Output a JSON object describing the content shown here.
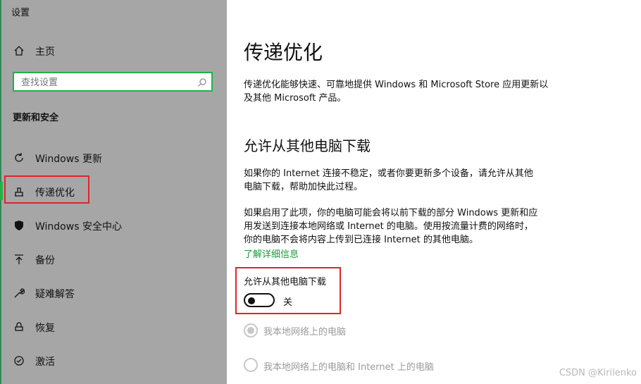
{
  "app": {
    "title": "设置"
  },
  "sidebar": {
    "home_label": "主页",
    "search_placeholder": "查找设置",
    "section_title": "更新和安全",
    "items": [
      {
        "label": "Windows 更新",
        "icon": "refresh-icon"
      },
      {
        "label": "传递优化",
        "icon": "delivery-optimization-icon",
        "active": true
      },
      {
        "label": "Windows 安全中心",
        "icon": "shield-icon"
      },
      {
        "label": "备份",
        "icon": "upload-arrow-icon"
      },
      {
        "label": "疑难解答",
        "icon": "wrench-icon"
      },
      {
        "label": "恢复",
        "icon": "recovery-icon"
      },
      {
        "label": "激活",
        "icon": "activation-icon"
      }
    ],
    "accent_color": "#22b14c"
  },
  "main": {
    "title": "传递优化",
    "intro_line1": "传递优化能够快速、可靠地提供 Windows 和 Microsoft Store 应用更新以",
    "intro_line2": "及其他 Microsoft 产品。",
    "section_title": "允许从其他电脑下载",
    "para1_line1": "如果你的 Internet 连接不稳定，或者你要更新多个设备，请允许从其他",
    "para1_line2": "电脑下载，帮助加快此过程。",
    "para2_line1": "如果启用了此项，你的电脑可能会将以前下载的部分 Windows 更新和应",
    "para2_line2": "用发送到连接本地网络或 Internet 的电脑。使用按流量计费的网络时，",
    "para2_line3": "你的电脑不会将内容上传到已连接 Internet 的其他电脑。",
    "learn_more": "了解详细信息",
    "toggle_label": "允许从其他电脑下载",
    "toggle_state": "关",
    "toggle_on": false,
    "radio1_label": "我本地网络上的电脑",
    "radio2_label": "我本地网络上的电脑和 Internet 上的电脑",
    "radio1_selected": true,
    "disabled_color": "#9a9a9a"
  },
  "watermark": "CSDN @Kirilenko",
  "highlight_color": "#e0242c"
}
